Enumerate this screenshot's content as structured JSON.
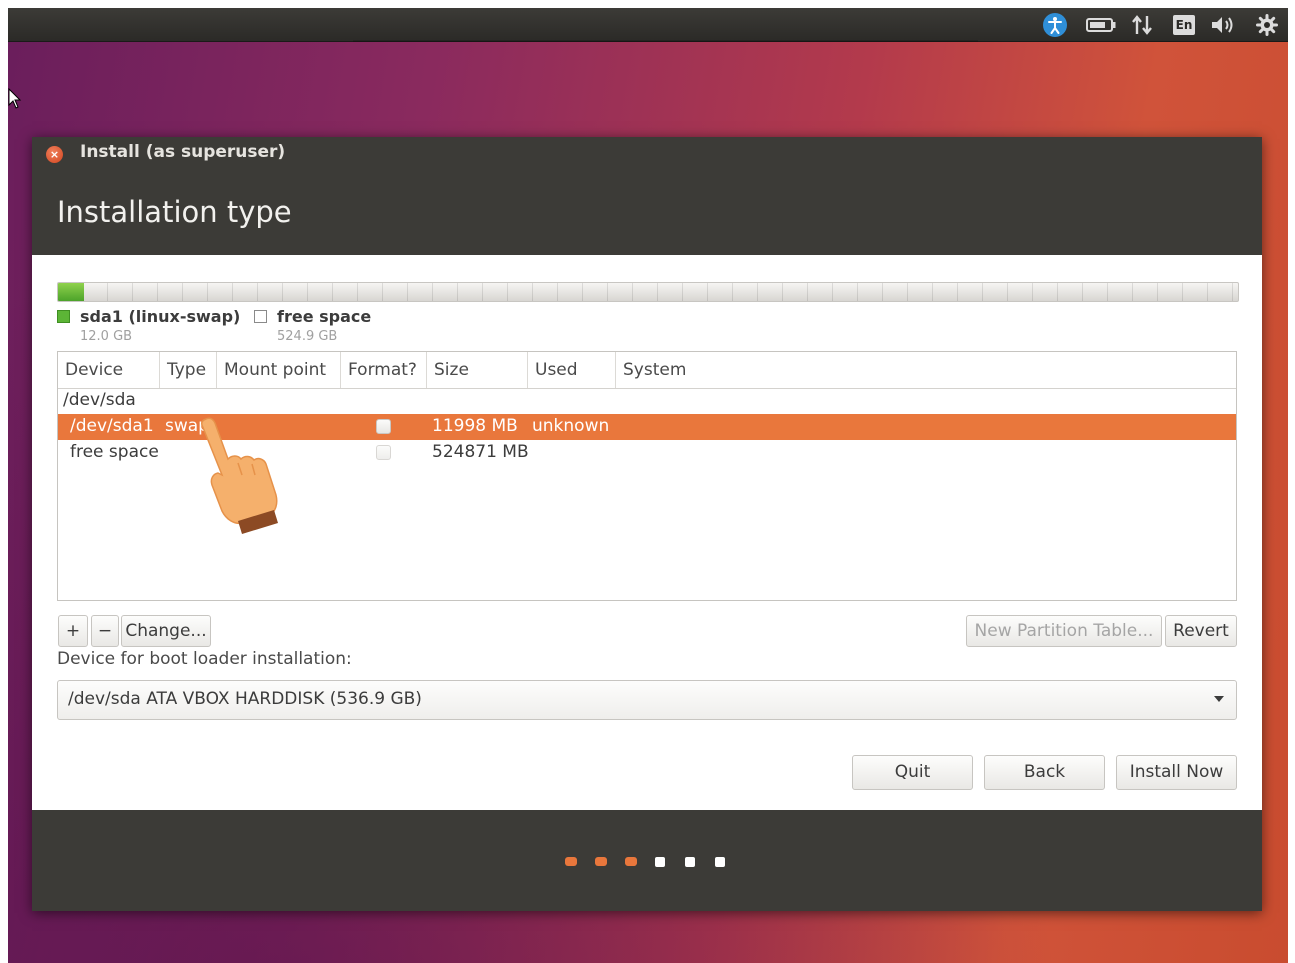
{
  "window": {
    "title": "Install (as superuser)",
    "page_title": "Installation type"
  },
  "topbar": {
    "language_indicator": "En",
    "icons": [
      "accessibility-icon",
      "battery-icon",
      "network-transfer-icon",
      "keyboard-layout-icon",
      "volume-icon",
      "settings-gear-icon"
    ]
  },
  "partition_bar": {
    "segments": [
      {
        "label": "sda1 (linux-swap)",
        "size": "12.0 GB",
        "color": "#5cb536",
        "fraction": 0.0223
      },
      {
        "label": "free space",
        "size": "524.9 GB",
        "color": "#ffffff",
        "fraction": 0.9777
      }
    ]
  },
  "table": {
    "headers": [
      "Device",
      "Type",
      "Mount point",
      "Format?",
      "Size",
      "Used",
      "System"
    ],
    "rows": [
      {
        "device": "/dev/sda",
        "type": "",
        "mount": "",
        "format": false,
        "size": "",
        "used": "",
        "system": "",
        "selected": false
      },
      {
        "device": "/dev/sda1",
        "type": "swap",
        "mount": "",
        "format": false,
        "size": "11998 MB",
        "used": "unknown",
        "system": "",
        "selected": true
      },
      {
        "device": "free space",
        "type": "",
        "mount": "",
        "format": false,
        "size": "524871 MB",
        "used": "",
        "system": "",
        "selected": false
      }
    ]
  },
  "buttons": {
    "add": "+",
    "remove": "−",
    "change": "Change...",
    "new_partition_table": "New Partition Table...",
    "revert": "Revert",
    "quit": "Quit",
    "back": "Back",
    "install_now": "Install Now"
  },
  "bootloader": {
    "label": "Device for boot loader installation:",
    "selected": "/dev/sda ATA VBOX HARDDISK (536.9 GB)"
  },
  "progress": {
    "steps_total": 6,
    "steps_done": 3,
    "done_color": "#e9773c",
    "pending_color": "#ffffff"
  },
  "colors": {
    "selection": "#e9773c",
    "titlebar": "#3c3b37"
  }
}
